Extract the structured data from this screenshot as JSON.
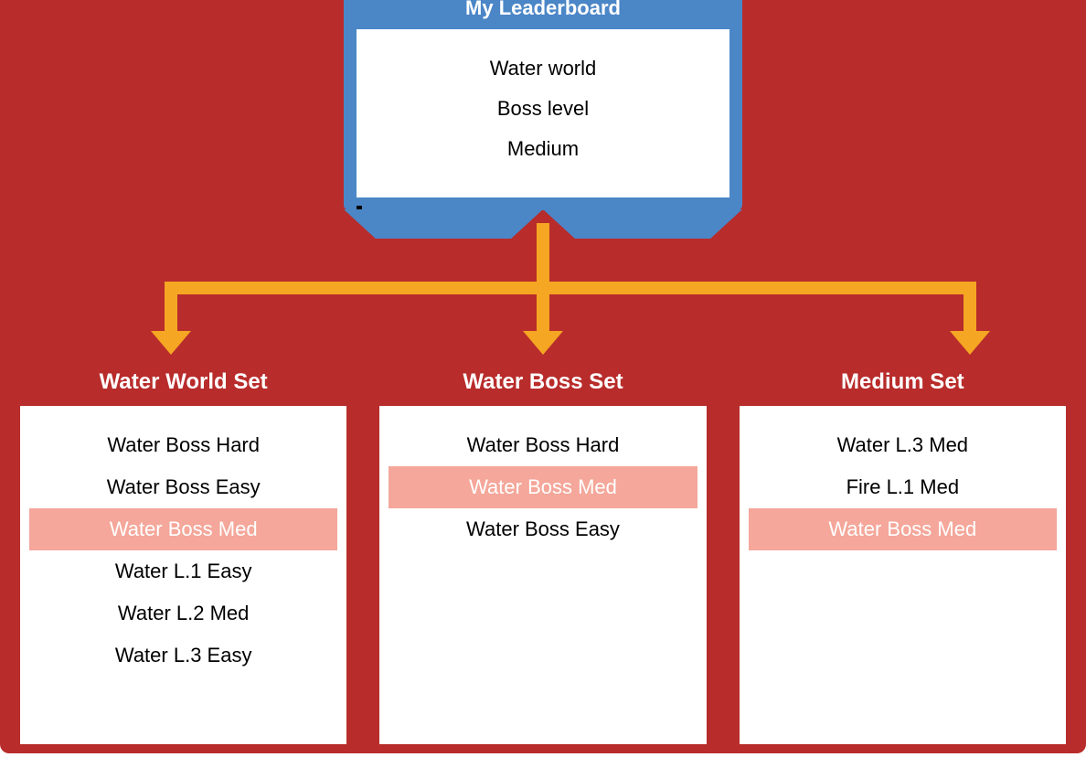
{
  "colors": {
    "red": "#b82c2b",
    "blue": "#4b86c7",
    "orange": "#f5a623",
    "pink": "#f4a79a"
  },
  "leaderboard": {
    "title": "My Leaderboard",
    "lines": [
      "Water world",
      "Boss level",
      "Medium"
    ]
  },
  "sets": [
    {
      "title": "Water World Set",
      "items": [
        {
          "label": "Water Boss Hard",
          "highlight": false
        },
        {
          "label": "Water Boss Easy",
          "highlight": false
        },
        {
          "label": "Water Boss Med",
          "highlight": true
        },
        {
          "label": "Water L.1 Easy",
          "highlight": false
        },
        {
          "label": "Water L.2 Med",
          "highlight": false
        },
        {
          "label": "Water L.3 Easy",
          "highlight": false
        }
      ]
    },
    {
      "title": "Water Boss Set",
      "items": [
        {
          "label": "Water Boss Hard",
          "highlight": false
        },
        {
          "label": "Water Boss Med",
          "highlight": true
        },
        {
          "label": "Water Boss Easy",
          "highlight": false
        }
      ]
    },
    {
      "title": "Medium Set",
      "items": [
        {
          "label": "Water L.3 Med",
          "highlight": false
        },
        {
          "label": "Fire L.1 Med",
          "highlight": false
        },
        {
          "label": "Water Boss Med",
          "highlight": true
        }
      ]
    }
  ]
}
